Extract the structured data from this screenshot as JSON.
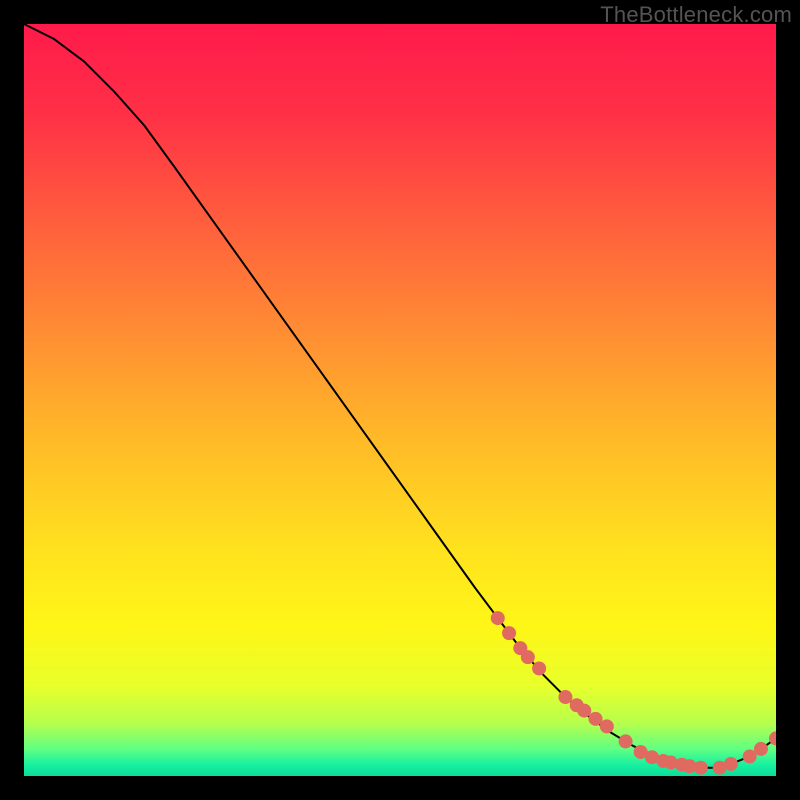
{
  "watermark": "TheBottleneck.com",
  "chart_data": {
    "type": "line",
    "title": "",
    "xlabel": "",
    "ylabel": "",
    "xlim": [
      0,
      100
    ],
    "ylim": [
      0,
      100
    ],
    "grid": false,
    "legend": false,
    "annotations": [],
    "background_gradient": {
      "stops": [
        {
          "offset": 0.0,
          "color": "#ff1a4b"
        },
        {
          "offset": 0.12,
          "color": "#ff3046"
        },
        {
          "offset": 0.25,
          "color": "#ff5a3e"
        },
        {
          "offset": 0.4,
          "color": "#ff8a34"
        },
        {
          "offset": 0.55,
          "color": "#ffb928"
        },
        {
          "offset": 0.7,
          "color": "#ffe21e"
        },
        {
          "offset": 0.8,
          "color": "#fff617"
        },
        {
          "offset": 0.88,
          "color": "#e8ff2a"
        },
        {
          "offset": 0.93,
          "color": "#b6ff4d"
        },
        {
          "offset": 0.965,
          "color": "#5eff84"
        },
        {
          "offset": 0.985,
          "color": "#17f0a0"
        },
        {
          "offset": 1.0,
          "color": "#0ddc99"
        }
      ]
    },
    "series": [
      {
        "name": "bottleneck-curve",
        "type": "line",
        "color": "#000000",
        "x": [
          0,
          4,
          8,
          12,
          16,
          20,
          25,
          30,
          35,
          40,
          45,
          50,
          55,
          60,
          63,
          66,
          69,
          72,
          75,
          78,
          81,
          84,
          86,
          88,
          90,
          92,
          94,
          96,
          98,
          100
        ],
        "y": [
          100,
          98,
          95,
          91,
          86.5,
          81,
          74,
          67,
          60,
          53,
          46,
          39,
          32,
          25,
          21,
          17,
          13.5,
          10.5,
          8,
          5.8,
          4,
          2.6,
          1.9,
          1.4,
          1.1,
          1.1,
          1.6,
          2.4,
          3.6,
          5
        ]
      },
      {
        "name": "highlight-points",
        "type": "scatter",
        "color": "#e06a60",
        "radius": 7,
        "x": [
          63,
          64.5,
          66,
          67,
          68.5,
          72,
          73.5,
          74.5,
          76,
          77.5,
          80,
          82,
          83.5,
          85,
          86,
          87.5,
          88.5,
          90,
          92.5,
          94,
          96.5,
          98,
          100
        ],
        "y": [
          21,
          19,
          17,
          15.8,
          14.3,
          10.5,
          9.4,
          8.7,
          7.6,
          6.6,
          4.6,
          3.2,
          2.5,
          2.0,
          1.8,
          1.5,
          1.3,
          1.1,
          1.1,
          1.6,
          2.6,
          3.6,
          5
        ]
      }
    ]
  }
}
